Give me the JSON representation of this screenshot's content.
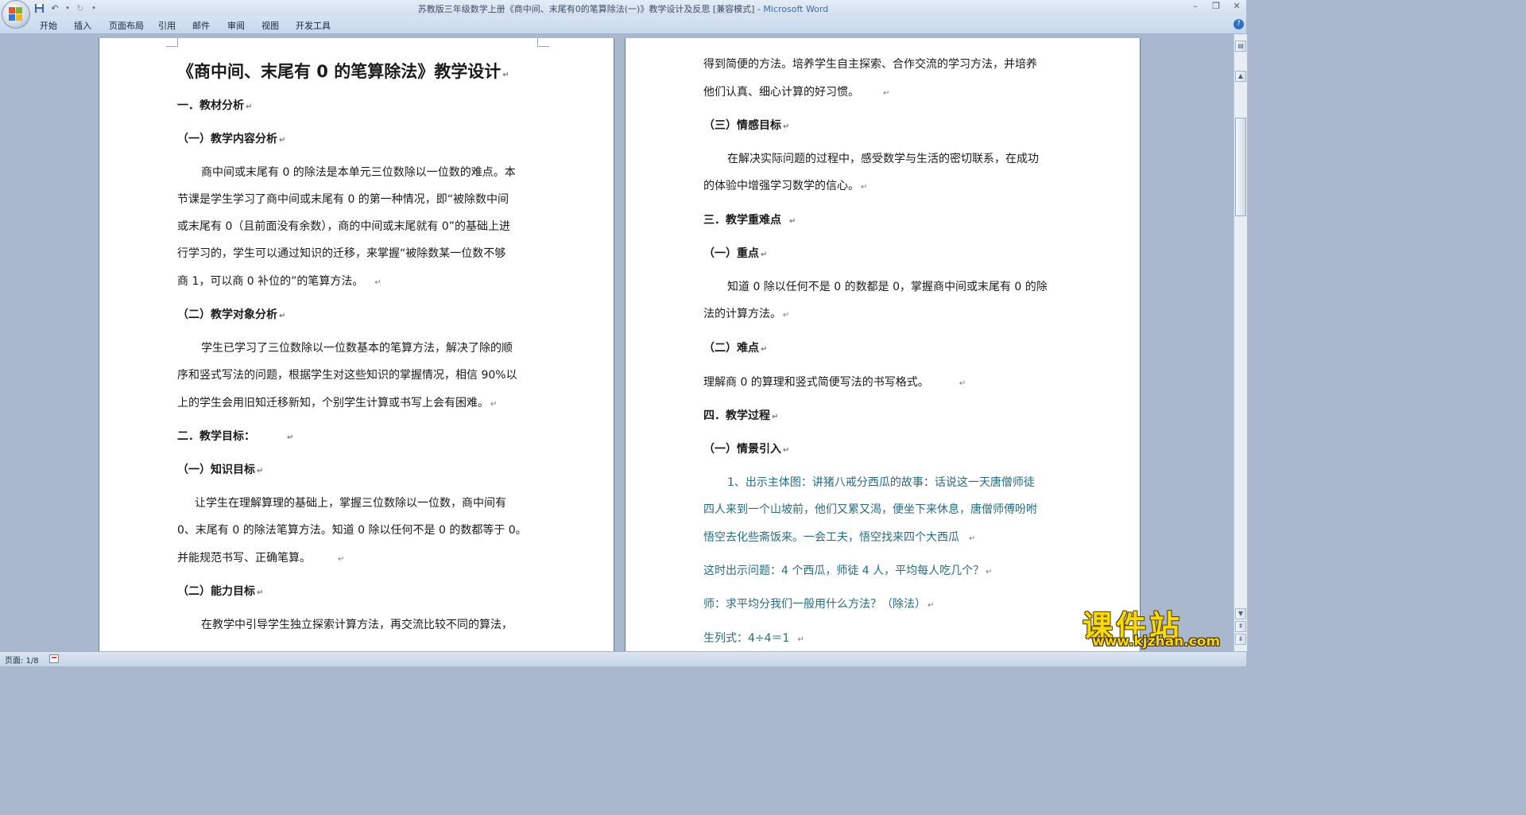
{
  "window": {
    "title_doc": "苏教版三年级数学上册《商中间、末尾有0的笔算除法(一)》教学设计及反思 [兼容模式] - ",
    "title_app": "Microsoft Word",
    "controls": [
      "–",
      "❐",
      "✕"
    ]
  },
  "ribbon": {
    "tabs": [
      "开始",
      "插入",
      "页面布局",
      "引用",
      "邮件",
      "审阅",
      "视图",
      "开发工具"
    ],
    "help": "?"
  },
  "pages": {
    "left": {
      "title": "《商中间、末尾有 0 的笔算除法》教学设计",
      "lines": [
        "一．教材分析",
        "（一）教学内容分析",
        "商中间或末尾有 0 的除法是本单元三位数除以一位数的难点。本",
        "节课是学生学习了商中间或末尾有 0 的第一种情况，即“被除数中间",
        "或末尾有 0（且前面没有余数），商的中间或末尾就有 0”的基础上进",
        "行学习的，学生可以通过知识的迁移，来掌握“被除数某一位数不够",
        "商 1，可以商 0 补位的”的笔算方法。",
        "（二）教学对象分析",
        "学生已学习了三位数除以一位数基本的笔算方法，解决了除的顺",
        "序和竖式写法的问题，根据学生对这些知识的掌握情况，相信 90%以",
        "上的学生会用旧知迁移新知，个别学生计算或书写上会有困难。",
        "二．教学目标：",
        "（一）知识目标",
        "让学生在理解算理的基础上，掌握三位数除以一位数，商中间有",
        "0、末尾有 0 的除法笔算方法。知道 0 除以任何不是 0 的数都等于 0。",
        "并能规范书写、正确笔算。",
        "（二）能力目标",
        "在教学中引导学生独立探索计算方法，再交流比较不同的算法，"
      ]
    },
    "right": {
      "lines": [
        "得到简便的方法。培养学生自主探索、合作交流的学习方法，并培养",
        "他们认真、细心计算的好习惯。",
        "（三）情感目标",
        "在解决实际问题的过程中，感受数学与生活的密切联系，在成功",
        "的体验中增强学习数学的信心。",
        "三．教学重难点",
        "（一）重点",
        "知道 0 除以任何不是 0 的数都是 0，掌握商中间或末尾有 0 的除",
        "法的计算方法。",
        "（二）难点",
        "理解商 0 的算理和竖式简便写法的书写格式。",
        "四．教学过程",
        "（一）情景引入",
        "1、出示主体图：讲猪八戒分西瓜的故事：话说这一天唐僧师徒",
        "四人来到一个山坡前，他们又累又渴，便坐下来休息，唐僧师傅吩咐",
        "悟空去化些斋饭来。一会工夫，悟空找来四个大西瓜",
        "这时出示问题：4 个西瓜，师徒 4 人，平均每人吃几个？",
        "师：求平均分我们一般用什么方法？（除法）",
        "生列式：4÷4＝1"
      ]
    }
  },
  "status": {
    "page": "页面: 1/8"
  },
  "watermark": {
    "cn": "课件站",
    "url": "www.kjzhan.com"
  }
}
